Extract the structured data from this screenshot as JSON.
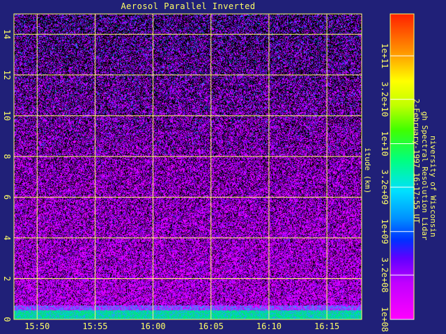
{
  "chart_data": {
    "type": "heatmap",
    "title": "Aerosol Parallel Inverted",
    "ylabel": "itude (km)",
    "x_ticks": [
      "15:50",
      "15:55",
      "16:00",
      "16:05",
      "16:10",
      "16:15"
    ],
    "x_range": [
      "15:48",
      "16:18"
    ],
    "y_ticks": [
      0,
      2,
      4,
      6,
      8,
      10,
      12,
      14
    ],
    "ylim": [
      0,
      15
    ],
    "colorbar": {
      "scale": "log",
      "range": [
        100000000.0,
        300000000000.0
      ],
      "tick_labels": [
        "1e+08",
        "3.2e+08",
        "1e+09",
        "3.2e+09",
        "1e+10",
        "3.2e+10",
        "1e+11"
      ]
    },
    "grid": true,
    "side_text": [
      "niversity of Wisconsin",
      "gh Spectral Resolution Lidar",
      "2-February-1997 16:17:55 UT"
    ]
  }
}
